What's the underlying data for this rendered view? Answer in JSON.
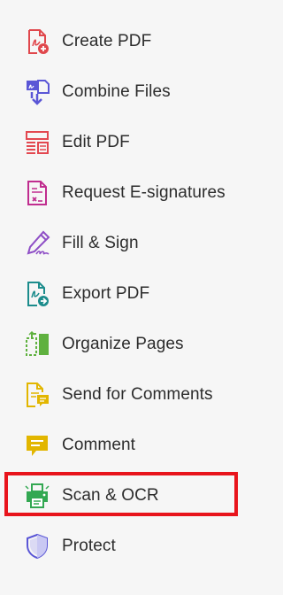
{
  "tools": [
    {
      "label": "Create PDF",
      "icon": "create-pdf-icon",
      "color": "#e0474c"
    },
    {
      "label": "Combine Files",
      "icon": "combine-files-icon",
      "color": "#5a56d6"
    },
    {
      "label": "Edit PDF",
      "icon": "edit-pdf-icon",
      "color": "#e34850"
    },
    {
      "label": "Request E-signatures",
      "icon": "request-esignature-icon",
      "color": "#c02d8f"
    },
    {
      "label": "Fill & Sign",
      "icon": "fill-sign-icon",
      "color": "#8e4ec6"
    },
    {
      "label": "Export PDF",
      "icon": "export-pdf-icon",
      "color": "#1c8c8c"
    },
    {
      "label": "Organize Pages",
      "icon": "organize-pages-icon",
      "color": "#5fb13f"
    },
    {
      "label": "Send for Comments",
      "icon": "send-for-comments-icon",
      "color": "#e2b600"
    },
    {
      "label": "Comment",
      "icon": "comment-icon",
      "color": "#e2b600"
    },
    {
      "label": "Scan & OCR",
      "icon": "scan-ocr-icon",
      "color": "#33a852"
    },
    {
      "label": "Protect",
      "icon": "protect-icon",
      "color": "#5a56d6"
    }
  ],
  "highlight": {
    "color": "#e8141c",
    "item": "Scan & OCR"
  }
}
